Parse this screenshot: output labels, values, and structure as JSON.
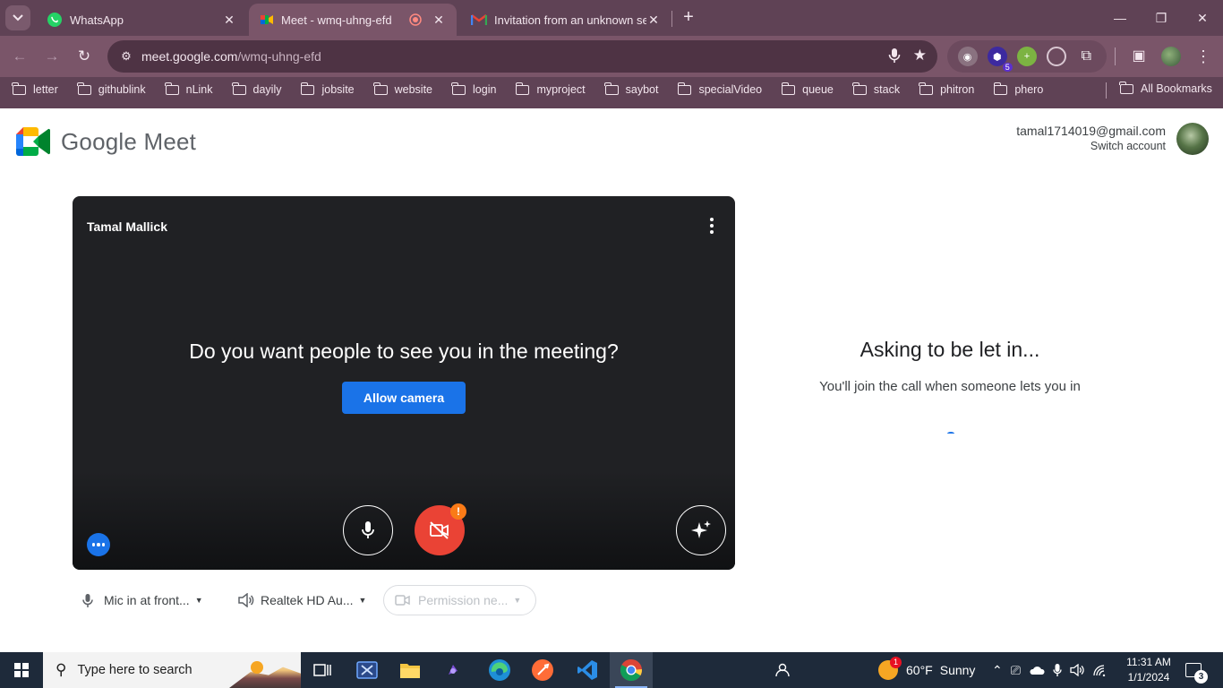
{
  "browser": {
    "tabs": [
      {
        "title": "WhatsApp",
        "active": false
      },
      {
        "title": "Meet - wmq-uhng-efd",
        "active": true
      },
      {
        "title": "Invitation from an unknown sender",
        "active": false
      }
    ],
    "url_host": "meet.google.com",
    "url_path": "/wmq-uhng-efd",
    "extension_badge": "5",
    "bookmarks": [
      "letter",
      "githublink",
      "nLink",
      "dayily",
      "jobsite",
      "website",
      "login",
      "myproject",
      "saybot",
      "specialVideo",
      "queue",
      "stack",
      "phitron",
      "phero"
    ],
    "all_bookmarks_label": "All Bookmarks"
  },
  "meet": {
    "brand": "Google Meet",
    "account_email": "tamal1714019@gmail.com",
    "switch_account": "Switch account",
    "preview": {
      "name": "Tamal Mallick",
      "question": "Do you want people to see you in the meeting?",
      "allow_camera": "Allow camera",
      "warning": "!"
    },
    "devices": {
      "mic": "Mic in at front...",
      "speaker": "Realtek HD Au...",
      "camera": "Permission ne..."
    },
    "waiting": {
      "title": "Asking to be let in...",
      "subtitle": "You'll join the call when someone lets you in"
    },
    "colors": {
      "blue": "#1a73e8",
      "red": "#ea4335",
      "orange": "#fa7b17"
    }
  },
  "taskbar": {
    "search_placeholder": "Type here to search",
    "weather_temp": "60°F",
    "weather_text": "Sunny",
    "time": "11:31 AM",
    "date": "1/1/2024",
    "notification_count": "3",
    "weather_badge": "1"
  }
}
